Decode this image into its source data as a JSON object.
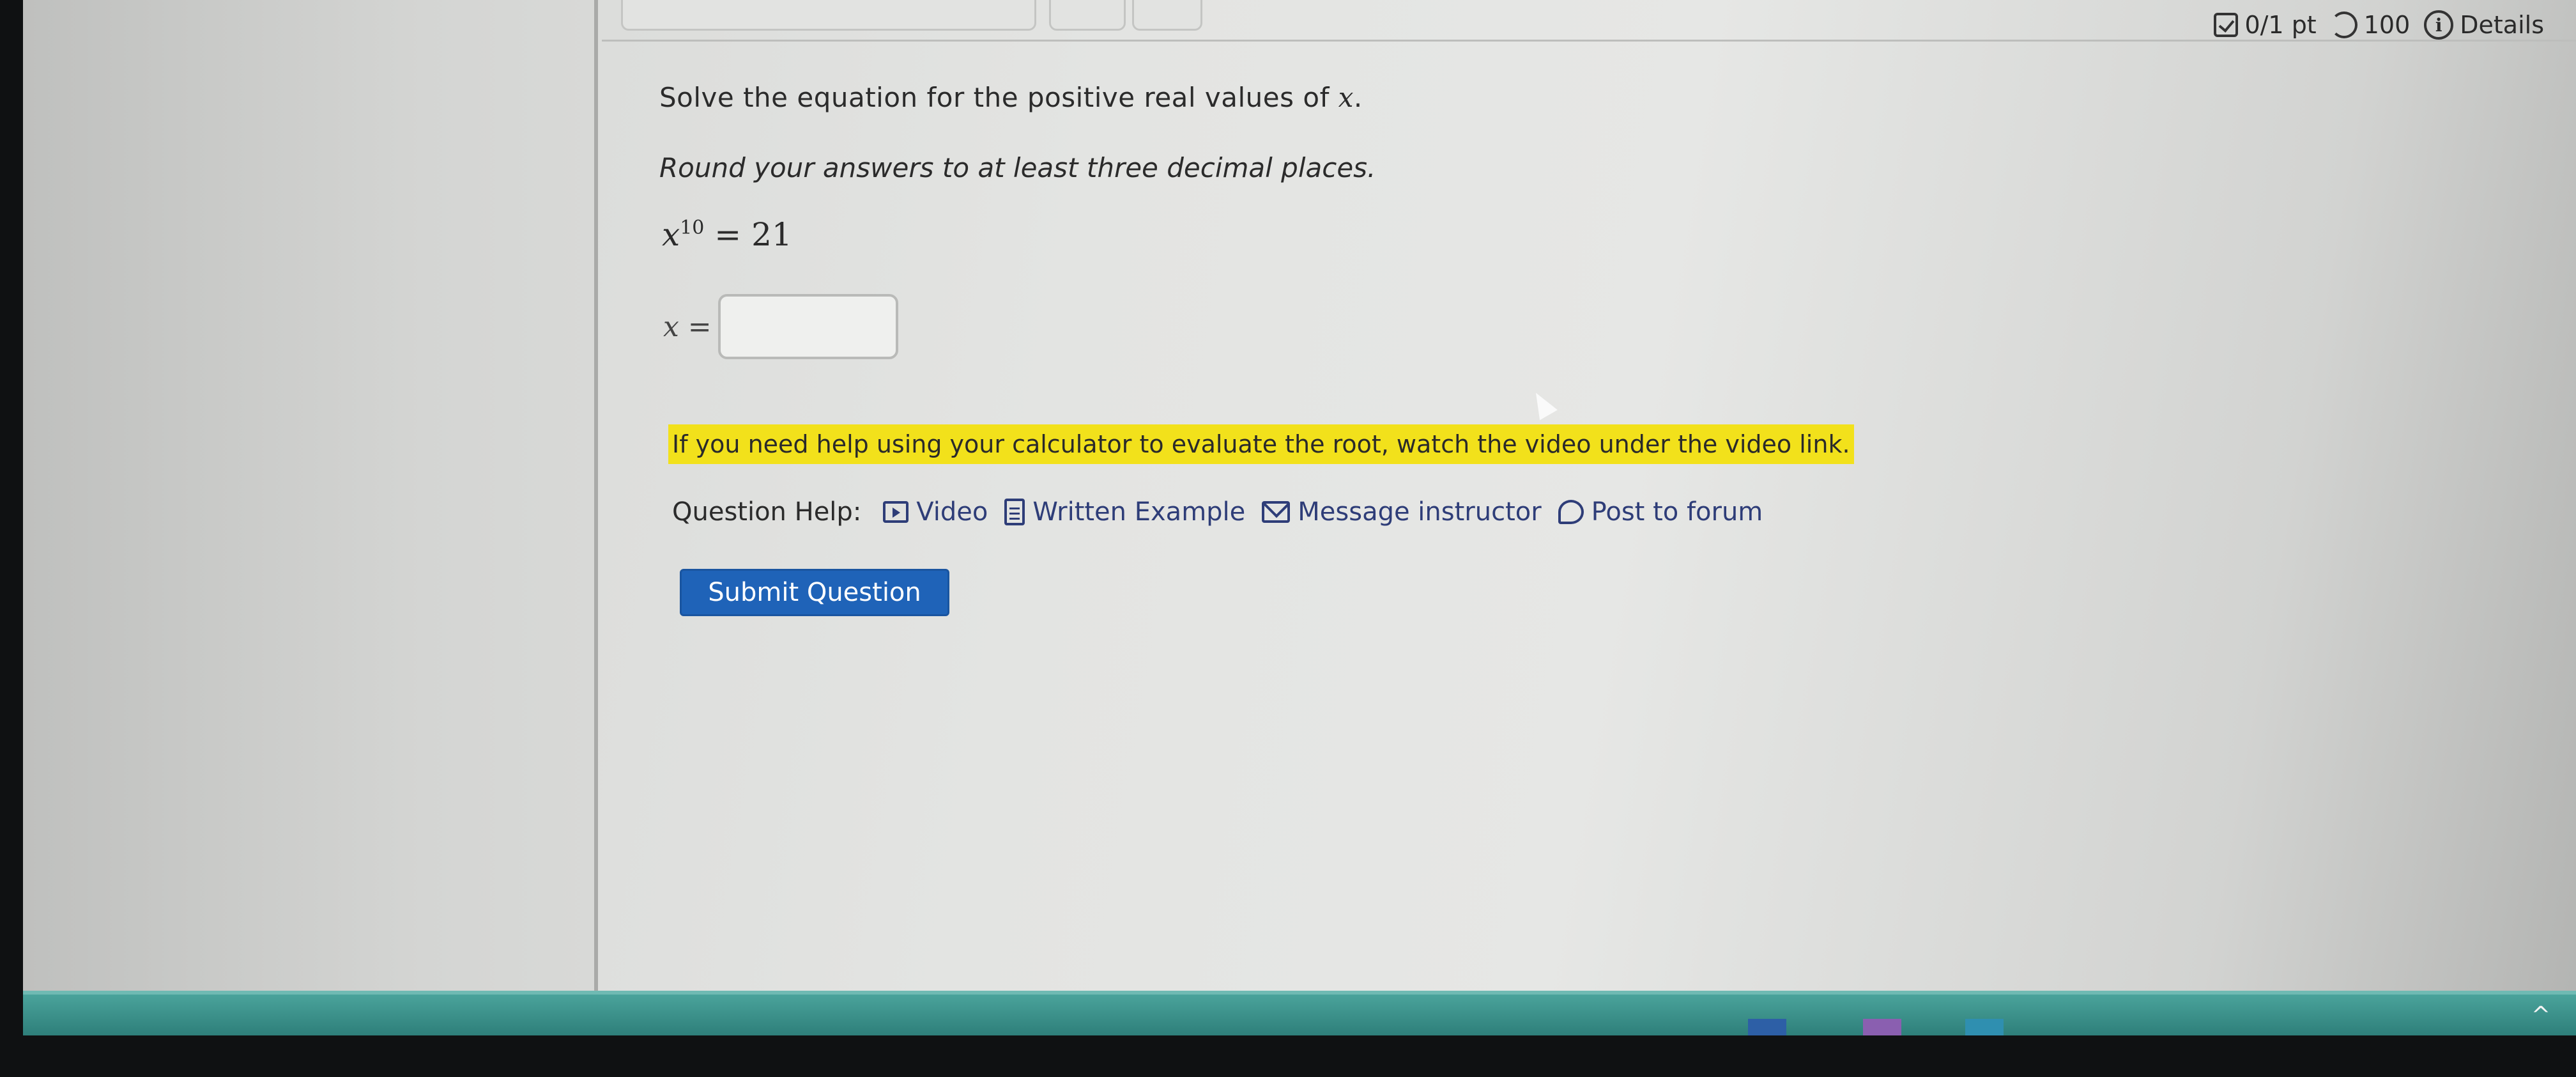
{
  "status": {
    "points": "0/1 pt",
    "attempts": "100",
    "details_label": "Details"
  },
  "question": {
    "prompt_before": "Solve the equation for the positive real values of ",
    "prompt_var": "x",
    "prompt_after": ".",
    "round_instruction": "Round your answers to at least three decimal places.",
    "eq_base": "x",
    "eq_exponent": "10",
    "eq_rhs": "= 21",
    "answer_label": "x =",
    "answer_value": ""
  },
  "hint": "If you need help using your calculator to evaluate the root, watch the video under the video link.",
  "help": {
    "label": "Question Help:",
    "video": "Video",
    "written_example": "Written Example",
    "message_instructor": "Message instructor",
    "post_forum": "Post to forum"
  },
  "submit_label": "Submit Question",
  "icons": {
    "points": "checkbox-icon",
    "attempts": "retry-icon",
    "details": "info-icon",
    "video": "video-play-icon",
    "written_example": "document-icon",
    "message": "mail-icon",
    "forum": "forum-bubble-icon"
  },
  "colors": {
    "highlight": "#f2e11b",
    "link": "#2e3d78",
    "submit": "#1f63b8",
    "taskbar": "#3b918a"
  }
}
